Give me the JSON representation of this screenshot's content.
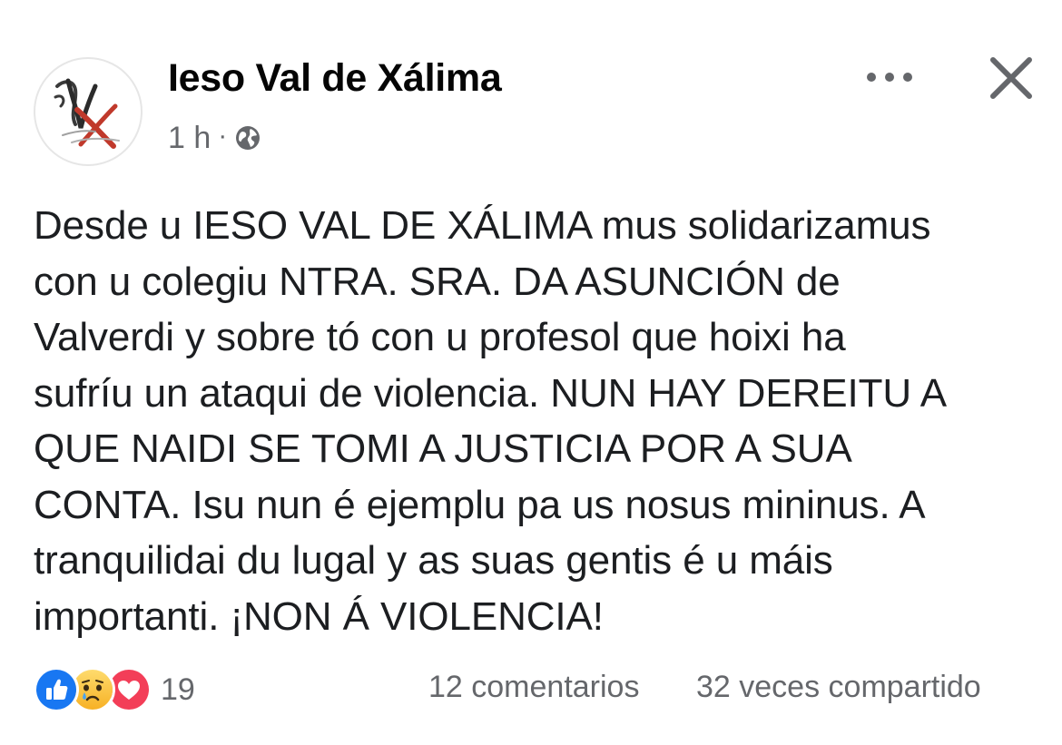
{
  "post": {
    "page_name": "Ieso Val de Xálima",
    "time": "1 h",
    "separator": "·",
    "privacy_icon": "globe-icon",
    "more_icon": "more-options-icon",
    "close_icon": "close-icon",
    "lines": [
      "Desde u IESO VAL DE XÁLIMA mus solidarizamus",
      "con u colegiu NTRA. SRA. DA ASUNCIÓN de",
      "Valverdi y sobre tó con u profesol que hoixi ha",
      "sufríu un ataqui de violencia. NUN HAY DEREITU A",
      "QUE NAIDI SE TOMI A JUSTICIA POR A SUA",
      "CONTA. Isu nun é ejemplu pa us nosus mininus. A",
      "tranquilidai du lugal y as suas gentis é u máis",
      "importanti. ¡NON Á VIOLENCIA!"
    ]
  },
  "footer": {
    "reactions": [
      "like-icon",
      "sad-icon",
      "love-icon"
    ],
    "reaction_count": "19",
    "comments": "12 comentarios",
    "shares": "32 veces compartido"
  },
  "colors": {
    "text": "#1c1e21",
    "secondary": "#65676b",
    "like": "#1877f2",
    "love": "#f33e58",
    "sad": "#f7b125",
    "logo_red": "#c0392b"
  }
}
